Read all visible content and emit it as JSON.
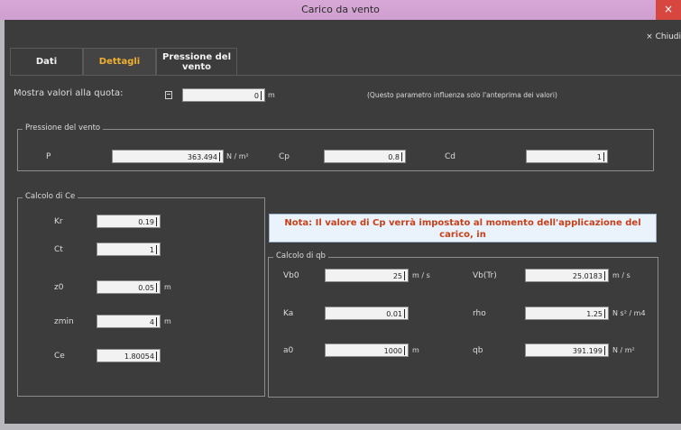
{
  "window": {
    "title": "Carico da vento",
    "close_label": "×",
    "chiudi_label": "× Chiudi"
  },
  "tabs": [
    {
      "label": "Dati"
    },
    {
      "label": "Dettagli"
    },
    {
      "label": "Pressione del vento"
    }
  ],
  "quota": {
    "label": "Mostra valori alla quota:",
    "value": "0",
    "unit": "m",
    "hint": "(Questo parametro influenza solo l'anteprima dei valori)"
  },
  "pressione": {
    "title": "Pressione del vento",
    "p_label": "P",
    "p_value": "363.494",
    "p_unit": "N / m²",
    "cp_label": "Cp",
    "cp_value": "0.8",
    "cd_label": "Cd",
    "cd_value": "1"
  },
  "ce": {
    "title": "Calcolo di Ce",
    "kr_label": "Kr",
    "kr_value": "0.19",
    "ct_label": "Ct",
    "ct_value": "1",
    "z0_label": "z0",
    "z0_value": "0.05",
    "z0_unit": "m",
    "zmin_label": "zmin",
    "zmin_value": "4",
    "zmin_unit": "m",
    "ce_label": "Ce",
    "ce_value": "1.80054"
  },
  "note": {
    "text": "Nota: Il valore di Cp verrà impostato al momento dell'applicazione del carico, in"
  },
  "qb": {
    "title": "Calcolo di qb",
    "vb0_label": "Vb0",
    "vb0_value": "25",
    "vb0_unit": "m / s",
    "vbtr_label": "Vb(Tr)",
    "vbtr_value": "25.0183",
    "vbtr_unit": "m / s",
    "ka_label": "Ka",
    "ka_value": "0.01",
    "rho_label": "rho",
    "rho_value": "1.25",
    "rho_unit": "N s² / m4",
    "a0_label": "a0",
    "a0_value": "1000",
    "a0_unit": "m",
    "qb_label": "qb",
    "qb_value": "391.199",
    "qb_unit": "N / m²"
  }
}
